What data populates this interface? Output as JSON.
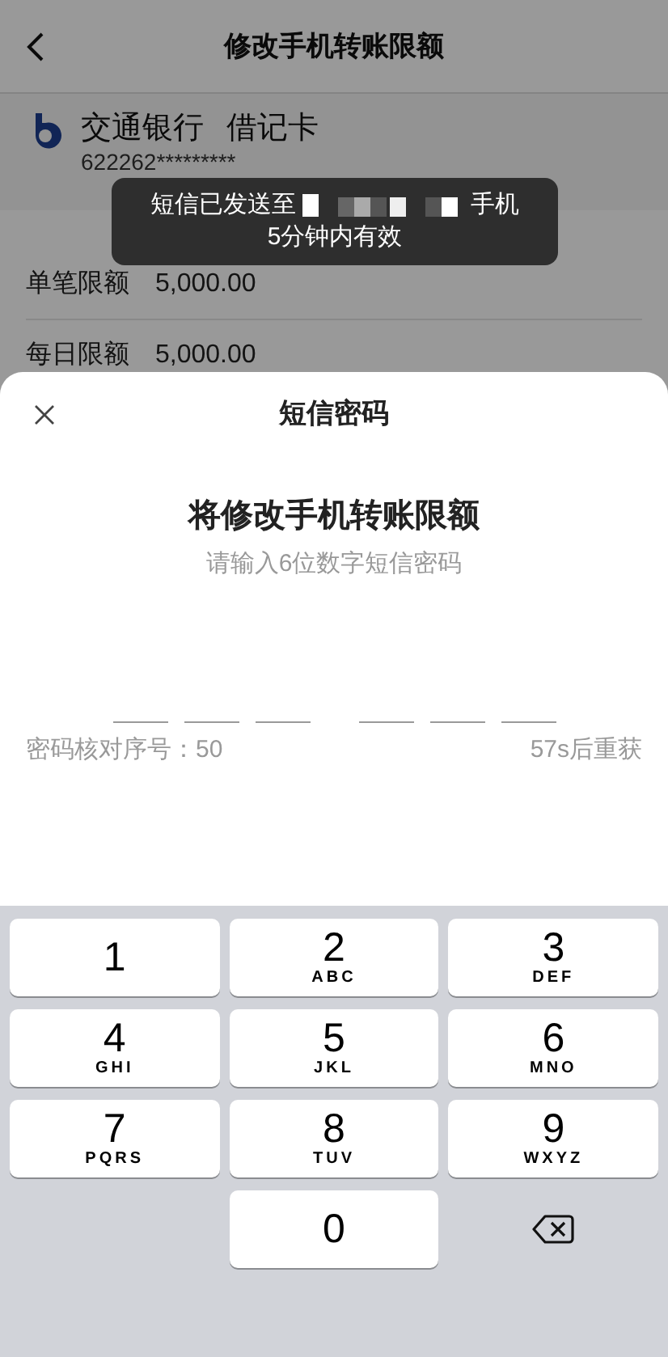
{
  "header": {
    "title": "修改手机转账限额"
  },
  "card": {
    "bank": "交通银行",
    "type": "借记卡",
    "number": "622262*********"
  },
  "limits": [
    {
      "label": "单笔限额",
      "value": "5,000.00"
    },
    {
      "label": "每日限额",
      "value": "5,000.00"
    }
  ],
  "toast": {
    "line1_start": "短信已发送至",
    "line1_end": "手机",
    "line2": "5分钟内有效"
  },
  "sheet": {
    "title": "短信密码",
    "heading": "将修改手机转账限额",
    "hint": "请输入6位数字短信密码",
    "slots": [
      {
        "filled": false
      },
      {
        "filled": false
      },
      {
        "filled": false
      },
      {
        "filled": false
      },
      {
        "filled": false
      },
      {
        "filled": false
      }
    ],
    "serial": "密码核对序号：50",
    "resend": "57s后重获"
  },
  "keypad": [
    {
      "kind": "digit",
      "digit": "1"
    },
    {
      "kind": "digit",
      "digit": "2",
      "letters": "ABC"
    },
    {
      "kind": "digit",
      "digit": "3",
      "letters": "DEF"
    },
    {
      "kind": "digit",
      "digit": "4",
      "letters": "GHI"
    },
    {
      "kind": "digit",
      "digit": "5",
      "letters": "JKL"
    },
    {
      "kind": "digit",
      "digit": "6",
      "letters": "MNO"
    },
    {
      "kind": "digit",
      "digit": "7",
      "letters": "PQRS"
    },
    {
      "kind": "digit",
      "digit": "8",
      "letters": "TUV"
    },
    {
      "kind": "digit",
      "digit": "9",
      "letters": "WXYZ"
    },
    {
      "kind": "blank"
    },
    {
      "kind": "digit",
      "digit": "0"
    },
    {
      "kind": "delete"
    }
  ]
}
